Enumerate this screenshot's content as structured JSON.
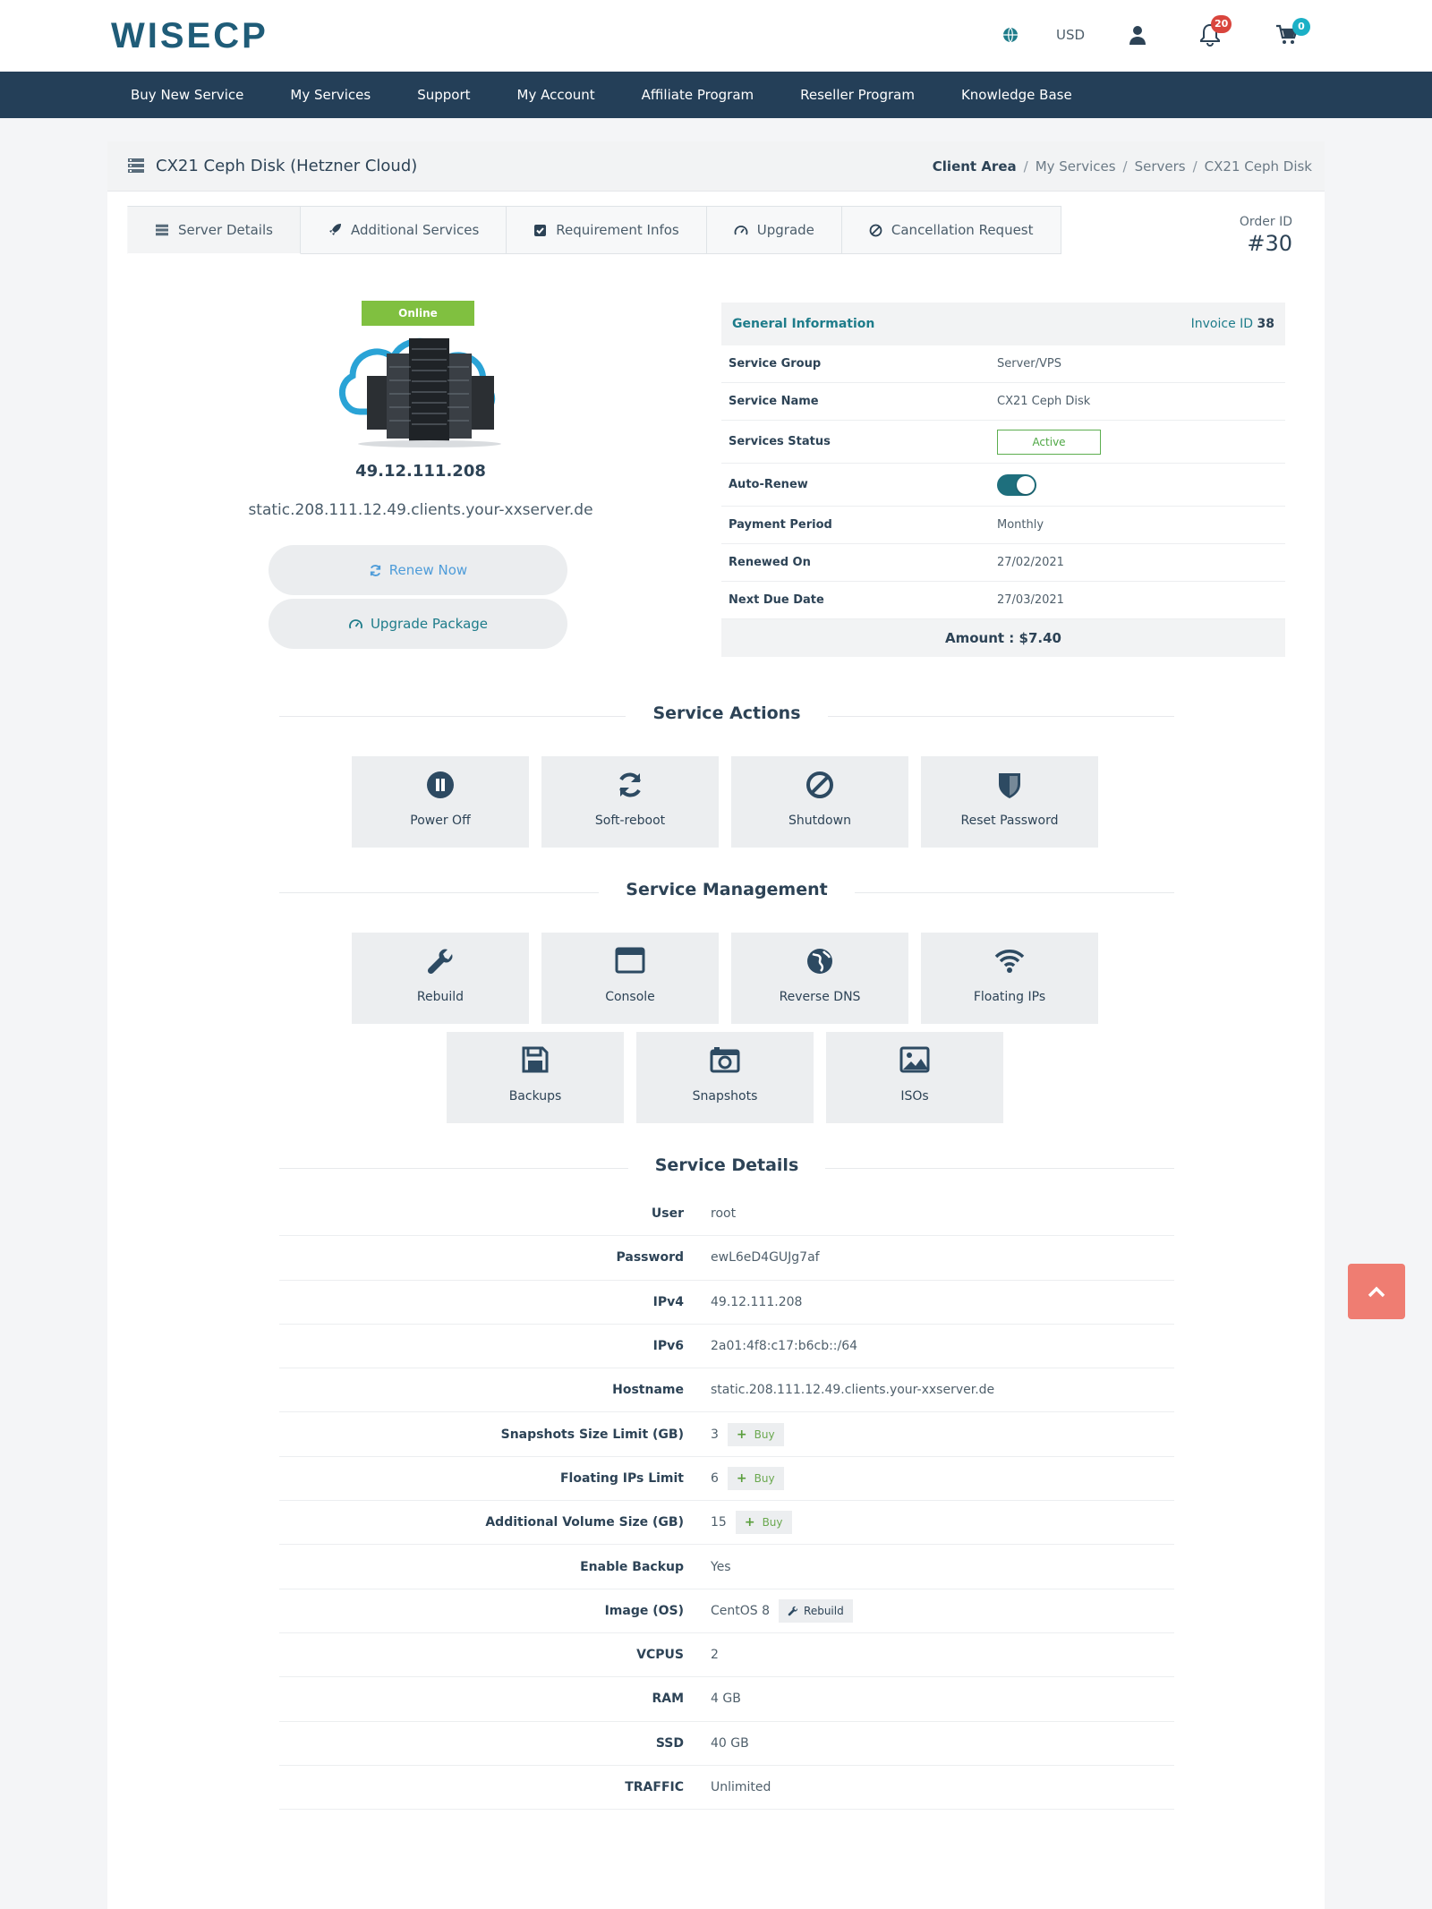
{
  "header": {
    "logo": "WISECP",
    "currency": "USD",
    "notification_count": "20",
    "cart_count": "0"
  },
  "nav": [
    "Buy New Service",
    "My Services",
    "Support",
    "My Account",
    "Affiliate Program",
    "Reseller Program",
    "Knowledge Base"
  ],
  "page": {
    "title": "CX21 Ceph Disk (Hetzner Cloud)",
    "breadcrumb": [
      "Client Area",
      "My Services",
      "Servers",
      "CX21 Ceph Disk"
    ]
  },
  "tabs": [
    "Server Details",
    "Additional Services",
    "Requirement Infos",
    "Upgrade",
    "Cancellation Request"
  ],
  "order": {
    "label": "Order ID",
    "value": "#30"
  },
  "server": {
    "status": "Online",
    "ip": "49.12.111.208",
    "hostname": "static.208.111.12.49.clients.your-xxserver.de",
    "renew_label": "Renew Now",
    "upgrade_label": "Upgrade Package"
  },
  "general_info": {
    "title": "General Information",
    "invoice_label": "Invoice ID",
    "invoice_id": "38",
    "rows": {
      "service_group": {
        "k": "Service Group",
        "v": "Server/VPS"
      },
      "service_name": {
        "k": "Service Name",
        "v": "CX21 Ceph Disk"
      },
      "status": {
        "k": "Services Status",
        "v": "Active"
      },
      "auto_renew": {
        "k": "Auto-Renew"
      },
      "payment_period": {
        "k": "Payment Period",
        "v": "Monthly"
      },
      "renewed_on": {
        "k": "Renewed On",
        "v": "27/02/2021"
      },
      "next_due": {
        "k": "Next Due Date",
        "v": "27/03/2021"
      }
    },
    "amount": "Amount : $7.40"
  },
  "service_actions": {
    "title": "Service Actions",
    "items": [
      "Power Off",
      "Soft-reboot",
      "Shutdown",
      "Reset Password"
    ]
  },
  "service_management": {
    "title": "Service Management",
    "items": [
      "Rebuild",
      "Console",
      "Reverse DNS",
      "Floating IPs",
      "Backups",
      "Snapshots",
      "ISOs"
    ]
  },
  "service_details": {
    "title": "Service Details",
    "buy_label": "Buy",
    "rebuild_label": "Rebuild",
    "rows": [
      {
        "k": "User",
        "v": "root"
      },
      {
        "k": "Password",
        "v": "ewL6eD4GUJg7af"
      },
      {
        "k": "IPv4",
        "v": "49.12.111.208"
      },
      {
        "k": "IPv6",
        "v": "2a01:4f8:c17:b6cb::/64"
      },
      {
        "k": "Hostname",
        "v": "static.208.111.12.49.clients.your-xxserver.de"
      },
      {
        "k": "Snapshots Size Limit (GB)",
        "v": "3"
      },
      {
        "k": "Floating IPs Limit",
        "v": "6"
      },
      {
        "k": "Additional Volume Size (GB)",
        "v": "15"
      },
      {
        "k": "Enable Backup",
        "v": "Yes"
      },
      {
        "k": "Image (OS)",
        "v": "CentOS 8"
      },
      {
        "k": "VCPUS",
        "v": "2"
      },
      {
        "k": "RAM",
        "v": "4 GB"
      },
      {
        "k": "SSD",
        "v": "40 GB"
      },
      {
        "k": "TRAFFIC",
        "v": "Unlimited"
      }
    ]
  },
  "colors": {
    "navbar": "#243f58",
    "accent": "#1e7c8a",
    "online": "#80c040",
    "scrolltop": "#ef7d72"
  }
}
